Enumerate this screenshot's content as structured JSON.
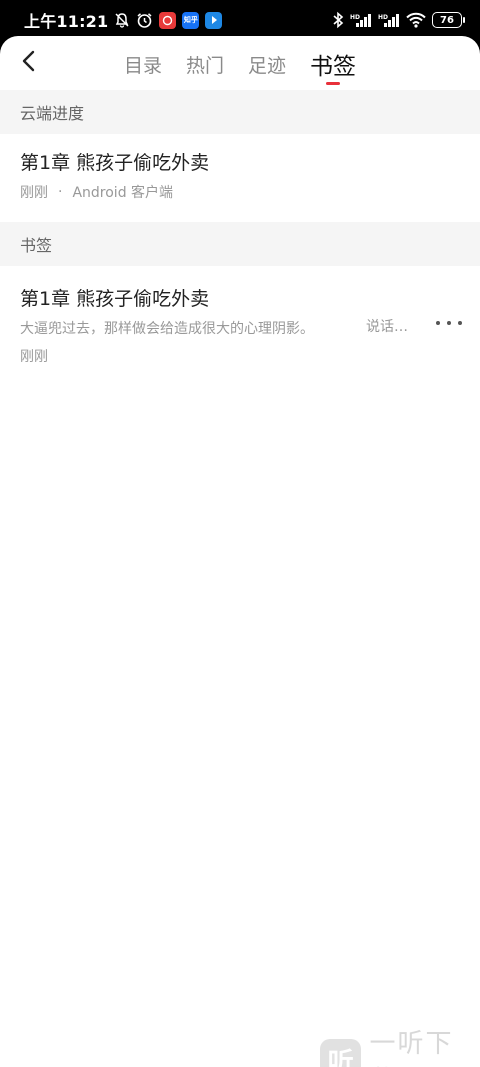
{
  "status_bar": {
    "time": "上午11:21",
    "app_badge_1": "知乎",
    "battery": "76"
  },
  "nav": {
    "tabs": [
      {
        "label": "目录"
      },
      {
        "label": "热门"
      },
      {
        "label": "足迹"
      },
      {
        "label": "书签",
        "active": true
      }
    ]
  },
  "cloud_progress": {
    "header": "云端进度",
    "title": "第1章 熊孩子偷吃外卖",
    "time": "刚刚",
    "separator": "·",
    "device": "Android 客户端"
  },
  "bookmarks": {
    "header": "书签",
    "items": [
      {
        "title": "第1章 熊孩子偷吃外卖",
        "excerpt": "大逼兜过去，那样做会给造成很大的心理阴影。",
        "note": "说话…",
        "time": "刚刚"
      }
    ]
  },
  "watermark": {
    "logo_char": "听",
    "text": "一听下载"
  },
  "colors": {
    "accent": "#e8303a",
    "section_bg": "#f5f5f5"
  }
}
